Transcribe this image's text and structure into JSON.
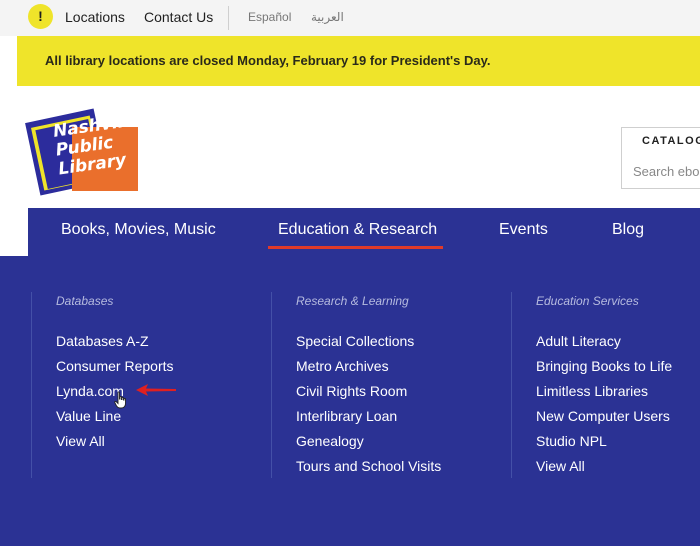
{
  "utility_bar": {
    "alert_icon_glyph": "!",
    "links": [
      "Locations",
      "Contact Us"
    ],
    "languages": [
      "Español",
      "العربية"
    ]
  },
  "alert": {
    "text": "All library locations are closed Monday, February 19 for President's Day."
  },
  "logo": {
    "lines": [
      "Nashville",
      "Public",
      "Library"
    ]
  },
  "catalog": {
    "label": "CATALOG",
    "placeholder": "Search ebooks"
  },
  "main_nav": {
    "items": [
      "Books, Movies, Music",
      "Education & Research",
      "Events",
      "Blog"
    ],
    "active": "Education & Research"
  },
  "mega_menu": {
    "columns": [
      {
        "heading": "Databases",
        "links": [
          "Databases A-Z",
          "Consumer Reports",
          "Lynda.com",
          "Value Line",
          "View All"
        ]
      },
      {
        "heading": "Research & Learning",
        "links": [
          "Special Collections",
          "Metro Archives",
          "Civil Rights Room",
          "Interlibrary Loan",
          "Genealogy",
          "Tours and School Visits"
        ]
      },
      {
        "heading": "Education Services",
        "links": [
          "Adult Literacy",
          "Bringing Books to Life",
          "Limitless Libraries",
          "New Computer Users",
          "Studio NPL",
          "View All"
        ]
      }
    ]
  },
  "colors": {
    "brand_blue": "#2b3294",
    "alert_yellow": "#efe42a",
    "logo_orange": "#ea6f2c",
    "active_underline": "#e03a2a",
    "annotation_arrow": "#e02020"
  }
}
